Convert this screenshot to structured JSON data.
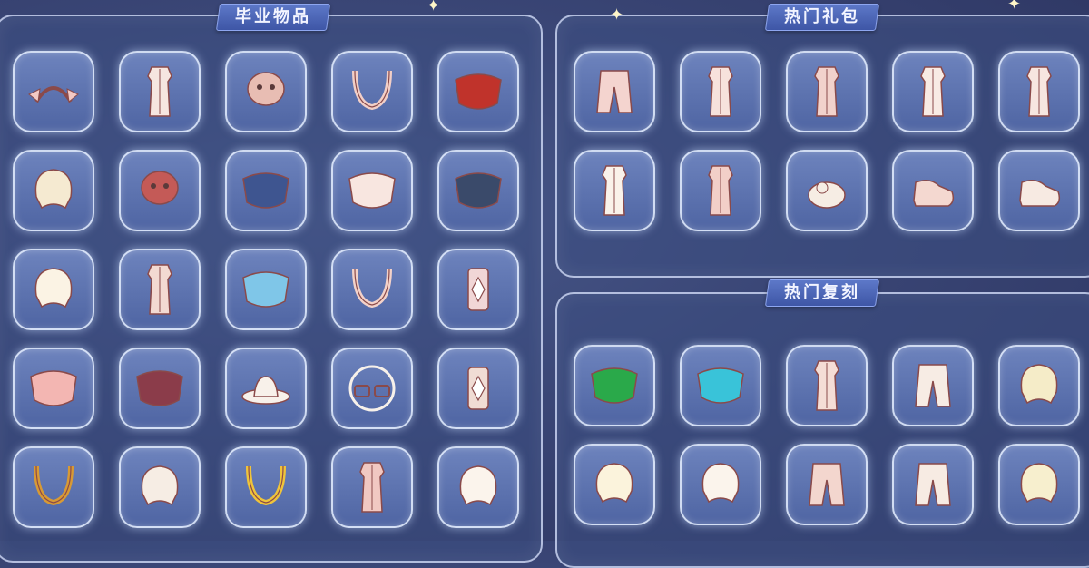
{
  "panels": {
    "graduation": {
      "title": "毕业物品",
      "items": [
        {
          "icon": "bow-headband-icon",
          "color": "#f3c9c4"
        },
        {
          "icon": "suit-outfit-icon",
          "color": "#f6e6e0"
        },
        {
          "icon": "bear-mask-icon",
          "color": "#e8bdb3"
        },
        {
          "icon": "necklace-icon",
          "color": "#f2cfc7"
        },
        {
          "icon": "red-cape-icon",
          "color": "#c0332b"
        },
        {
          "icon": "fox-ears-hair-icon",
          "color": "#f5ead1"
        },
        {
          "icon": "owl-mask-icon",
          "color": "#c45a57"
        },
        {
          "icon": "blue-wing-cape-icon",
          "color": "#3e5590"
        },
        {
          "icon": "white-wing-cape-icon",
          "color": "#f8e6e0"
        },
        {
          "icon": "dark-wing-cape-icon",
          "color": "#3a4a6a"
        },
        {
          "icon": "long-hair-icon",
          "color": "#fbf3e4"
        },
        {
          "icon": "dress-outfit-icon",
          "color": "#f3dad2"
        },
        {
          "icon": "blue-bow-cape-icon",
          "color": "#7fc6e8"
        },
        {
          "icon": "scarf-icon",
          "color": "#f3d2c9"
        },
        {
          "icon": "amulet-icon",
          "color": "#f1d6d6"
        },
        {
          "icon": "pink-shell-cape-icon",
          "color": "#f3b6b2"
        },
        {
          "icon": "maroon-cape-icon",
          "color": "#8b3c4a"
        },
        {
          "icon": "white-hat-icon",
          "color": "#f8f1ea"
        },
        {
          "icon": "glasses-icon",
          "color": "#f7f1ea"
        },
        {
          "icon": "lantern-icon",
          "color": "#f0dcd4"
        },
        {
          "icon": "gold-staff-icon",
          "color": "#d89a34"
        },
        {
          "icon": "feather-hair-icon",
          "color": "#f6ede4"
        },
        {
          "icon": "gold-scarf-icon",
          "color": "#f0c43a"
        },
        {
          "icon": "pink-outfit-icon",
          "color": "#f1c8c2"
        },
        {
          "icon": "bun-hair-icon",
          "color": "#fbf4ec"
        }
      ]
    },
    "hot_packs": {
      "title": "热门礼包",
      "items": [
        {
          "icon": "pants-outfit-icon",
          "color": "#f4d4cf"
        },
        {
          "icon": "robe-outfit-icon",
          "color": "#f7e2dc"
        },
        {
          "icon": "short-outfit-icon",
          "color": "#f2d2cc"
        },
        {
          "icon": "kimono-outfit-icon",
          "color": "#f8ebe4"
        },
        {
          "icon": "bow-dress-icon",
          "color": "#f7e6e0"
        },
        {
          "icon": "gown-outfit-icon",
          "color": "#faf2ea"
        },
        {
          "icon": "long-dress-icon",
          "color": "#f2cfc8"
        },
        {
          "icon": "bunny-prop-icon",
          "color": "#f6ede4"
        },
        {
          "icon": "pink-shoes-icon",
          "color": "#f4d8d0"
        },
        {
          "icon": "bow-shoes-icon",
          "color": "#f7eae2"
        }
      ]
    },
    "hot_reprint": {
      "title": "热门复刻",
      "items": [
        {
          "icon": "green-leaf-cape-icon",
          "color": "#2aa94a"
        },
        {
          "icon": "cyan-wave-cape-icon",
          "color": "#39c3d9"
        },
        {
          "icon": "ninja-outfit-icon",
          "color": "#f4ddd6"
        },
        {
          "icon": "baggy-pants-icon",
          "color": "#f7ece4"
        },
        {
          "icon": "wavy-hair-icon",
          "color": "#f5ecc8"
        },
        {
          "icon": "short-hair-icon",
          "color": "#fbf3dc"
        },
        {
          "icon": "cat-ears-hair-icon",
          "color": "#fbf4ec"
        },
        {
          "icon": "jumpsuit-icon",
          "color": "#f3d6ce"
        },
        {
          "icon": "cargo-pants-icon",
          "color": "#f7ebe3"
        },
        {
          "icon": "flower-crown-hair-icon",
          "color": "#f7efce"
        }
      ]
    }
  }
}
